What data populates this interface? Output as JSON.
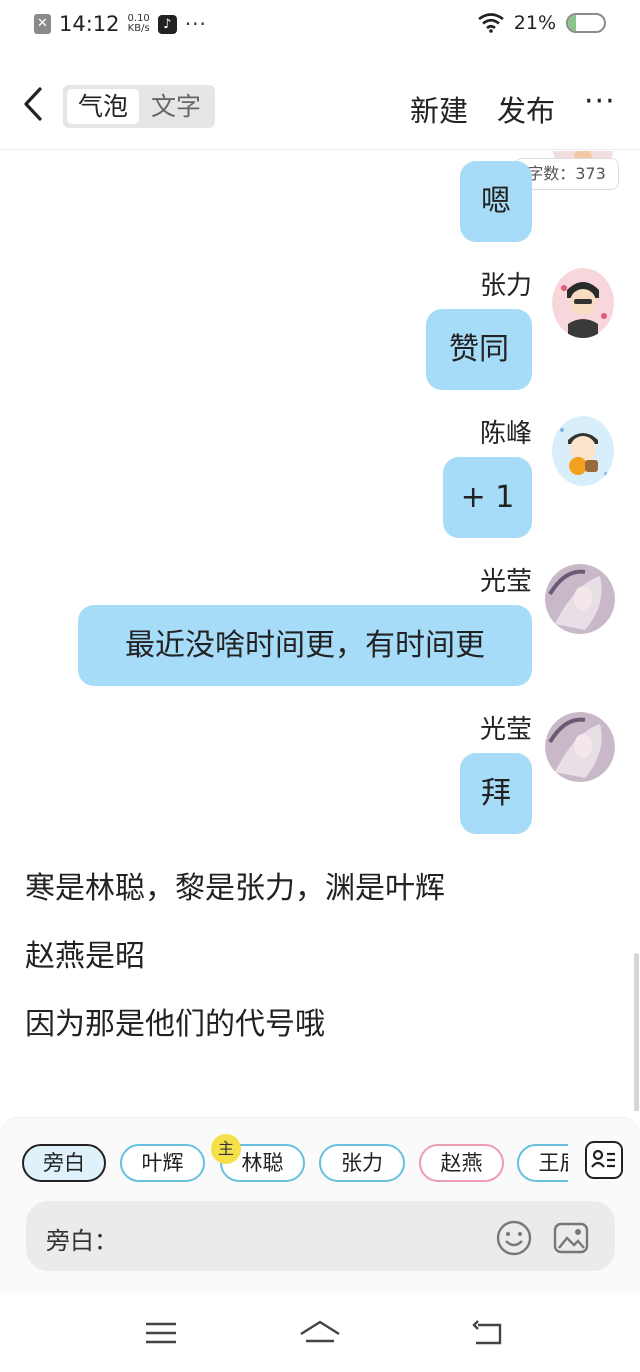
{
  "status_bar": {
    "time": "14:12",
    "speed_value": "0.10",
    "speed_unit": "KB/s",
    "battery": "21%",
    "battery_level": 0.21,
    "icons": [
      "notification-off-icon",
      "tiktok-icon",
      "more-dots-icon",
      "wifi-icon",
      "battery-icon"
    ]
  },
  "header": {
    "segment_bubble": "气泡",
    "segment_text": "文字",
    "new_label": "新建",
    "publish_label": "发布",
    "more_label": "···"
  },
  "chat": {
    "word_count": "字数：373",
    "messages": [
      {
        "sender": "",
        "text": "嗯"
      },
      {
        "sender": "张力",
        "text": "赞同"
      },
      {
        "sender": "陈峰",
        "text": "+ 1"
      },
      {
        "sender": "光莹",
        "text": "最近没啥时间更，有时间更"
      },
      {
        "sender": "光莹",
        "text": "拜"
      }
    ],
    "narration": [
      "寒是林聪，黎是张力，渊是叶辉",
      "赵燕是昭",
      "因为那是他们的代号哦"
    ]
  },
  "composer": {
    "chips": [
      "旁白",
      "叶辉",
      "林聪",
      "张力",
      "赵燕",
      "王辰"
    ],
    "host_badge": "主",
    "input_label": "旁白：",
    "input_value": "",
    "input_placeholder": ""
  },
  "colors": {
    "bubble": "#a6dcf8",
    "chip_border": "#66c0df",
    "chip_pink": "#ef9bb0",
    "host_badge": "#f5e04a"
  }
}
